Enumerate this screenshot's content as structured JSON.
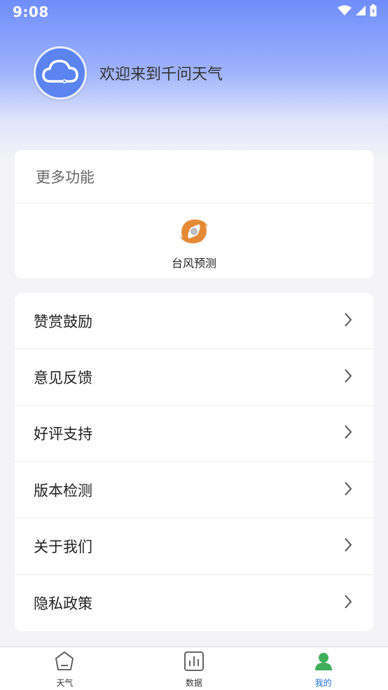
{
  "status_bar": {
    "time": "9:08",
    "icons": [
      "wifi-icon",
      "signal-icon",
      "battery-icon"
    ]
  },
  "profile": {
    "avatar_icon": "cloud-icon",
    "welcome_text": "欢迎来到千问天气"
  },
  "more_functions": {
    "title": "更多功能",
    "items": [
      {
        "label": "台风预测",
        "icon": "typhoon-icon"
      }
    ]
  },
  "menu": {
    "items": [
      {
        "label": "赞赏鼓励"
      },
      {
        "label": "意见反馈"
      },
      {
        "label": "好评支持"
      },
      {
        "label": "版本检测"
      },
      {
        "label": "关于我们"
      },
      {
        "label": "隐私政策"
      }
    ]
  },
  "tabbar": {
    "tabs": [
      {
        "label": "天气",
        "icon": "weather-home-icon",
        "active": false
      },
      {
        "label": "数据",
        "icon": "chart-icon",
        "active": false
      },
      {
        "label": "我的",
        "icon": "user-icon",
        "active": true
      }
    ]
  },
  "colors": {
    "header_top": "#6f8dfb",
    "avatar_bg": "#5b84f0",
    "active_tab": "#1e6fd9",
    "active_tab_icon": "#3fae5a",
    "typhoon": "#e48a36"
  }
}
